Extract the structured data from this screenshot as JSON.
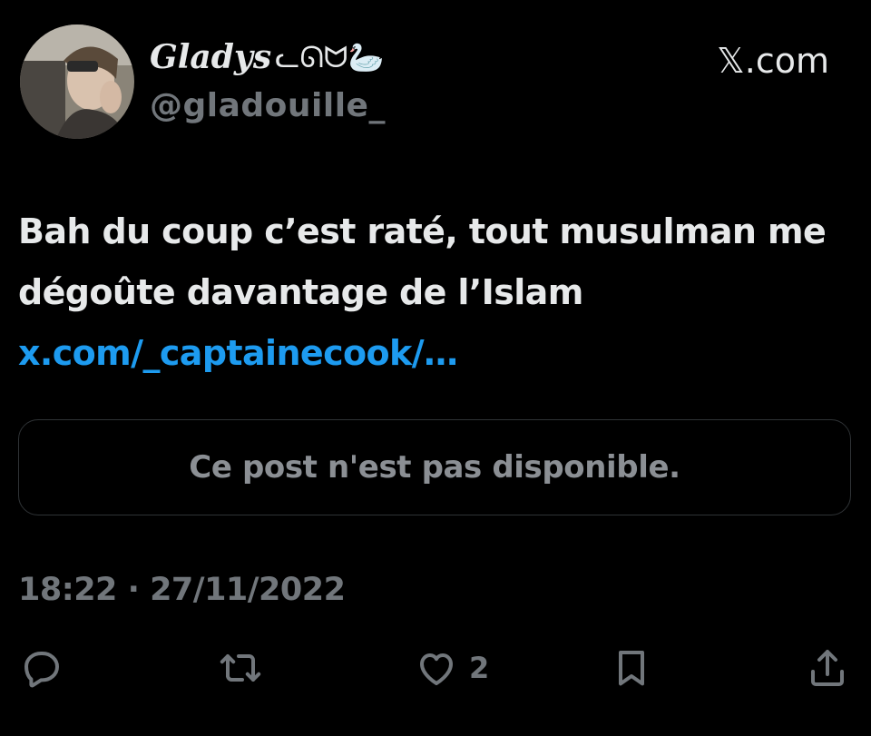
{
  "author": {
    "display_name": "Gladys",
    "name_decoration": "ᓚᘏᗢ🦢",
    "handle": "@gladouille_",
    "avatar": "profile-photo"
  },
  "site": {
    "label": "𝕏.com"
  },
  "post": {
    "text": "Bah du coup c’est raté, tout musulman me dégoûte davantage de l’Islam ",
    "link_text": "x.com/_captainecook/…"
  },
  "quoted_post": {
    "text": "Ce post n'est pas disponible."
  },
  "meta": {
    "timestamp": "18:22 · 27/11/2022"
  },
  "actions": {
    "reply_icon": "reply-icon",
    "repost_icon": "repost-icon",
    "like_icon": "heart-icon",
    "like_count": "2",
    "bookmark_icon": "bookmark-icon",
    "share_icon": "share-icon"
  },
  "colors": {
    "background": "#000000",
    "text": "#e7e9ea",
    "secondary": "#71767b",
    "link": "#1d9bf0",
    "border": "#2f3336"
  }
}
